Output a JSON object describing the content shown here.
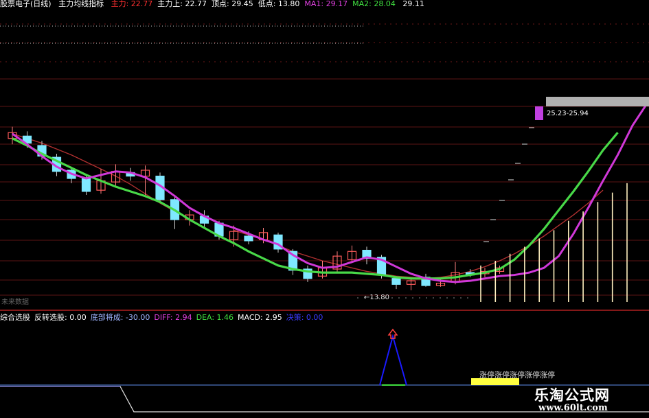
{
  "header": {
    "name": "股票电子(日线)",
    "indicator": "主力均线指标",
    "items": [
      {
        "label": "主力:",
        "value": "22.77",
        "color": "#ff3030"
      },
      {
        "label": "主力上:",
        "value": "22.77",
        "color": "#ffffff"
      },
      {
        "label": "顶点:",
        "value": "29.45",
        "color": "#ffffff"
      },
      {
        "label": "低点:",
        "value": "13.80",
        "color": "#ffffff"
      },
      {
        "label": "MA1:",
        "value": "29.17",
        "color": "#e040e0"
      },
      {
        "label": "MA2:",
        "value": "28.04",
        "color": "#40e040"
      },
      {
        "label": "",
        "value": "29.11",
        "color": "#ffffff"
      }
    ]
  },
  "indicator_bar": {
    "items": [
      {
        "text": "综合选股",
        "color": "#ffffff"
      },
      {
        "text": "反转选股: 0.00",
        "color": "#ffffff"
      },
      {
        "text": "底部将成: -30.00",
        "color": "#9fb4ff"
      },
      {
        "text": "DIFF: 2.94",
        "color": "#e040e0"
      },
      {
        "text": "DEA: 1.46",
        "color": "#40e040"
      },
      {
        "text": "MACD: 2.95",
        "color": "#ffffff"
      },
      {
        "text": "决策: 0.00",
        "color": "#3a3aff"
      }
    ]
  },
  "labels": {
    "low_marker": "←13.80",
    "target_range": "25.23-25.94",
    "future_days": "未来数据",
    "lower_text": "涨停涨停涨停涨停涨停"
  },
  "watermark": {
    "site_name": "乐淘公式网",
    "site_url": "www.60lt.com"
  },
  "colors": {
    "up_candle": "#ff5a5a",
    "down_candle": "#7fe8ff",
    "ma1": "#d038d8",
    "ma2": "#48d848",
    "ma3": "#b03030",
    "forecast_bar": "#fff0c0",
    "grid": "#7a1a1a"
  },
  "chart_data": [
    {
      "type": "candlestick",
      "title": "股票电子(日线)",
      "ylim": [
        12.5,
        30.0
      ],
      "low": 13.8,
      "high": 29.45,
      "target_range": [
        25.23,
        25.94
      ],
      "candles": [
        {
          "open": 26.4,
          "close": 26.9,
          "high": 27.4,
          "low": 25.9
        },
        {
          "open": 26.6,
          "close": 26.0,
          "high": 27.0,
          "low": 25.6
        },
        {
          "open": 25.8,
          "close": 24.9,
          "high": 26.2,
          "low": 24.6
        },
        {
          "open": 24.8,
          "close": 23.6,
          "high": 25.1,
          "low": 23.2
        },
        {
          "open": 23.7,
          "close": 23.0,
          "high": 24.0,
          "low": 22.6
        },
        {
          "open": 23.0,
          "close": 21.9,
          "high": 23.3,
          "low": 21.6
        },
        {
          "open": 22.0,
          "close": 22.8,
          "high": 23.8,
          "low": 21.7
        },
        {
          "open": 22.7,
          "close": 23.6,
          "high": 24.2,
          "low": 22.4
        },
        {
          "open": 23.5,
          "close": 23.2,
          "high": 23.9,
          "low": 22.8
        },
        {
          "open": 23.2,
          "close": 23.7,
          "high": 24.1,
          "low": 21.4
        },
        {
          "open": 23.2,
          "close": 21.2,
          "high": 23.5,
          "low": 20.9
        },
        {
          "open": 21.2,
          "close": 19.5,
          "high": 21.5,
          "low": 18.7
        },
        {
          "open": 19.5,
          "close": 19.9,
          "high": 20.3,
          "low": 19.0
        },
        {
          "open": 19.8,
          "close": 19.2,
          "high": 20.3,
          "low": 18.8
        },
        {
          "open": 19.2,
          "close": 18.1,
          "high": 19.4,
          "low": 17.8
        },
        {
          "open": 17.8,
          "close": 18.5,
          "high": 19.0,
          "low": 17.2
        },
        {
          "open": 18.1,
          "close": 17.7,
          "high": 18.5,
          "low": 17.4
        },
        {
          "open": 17.8,
          "close": 18.4,
          "high": 18.8,
          "low": 17.5
        },
        {
          "open": 18.2,
          "close": 17.0,
          "high": 18.4,
          "low": 16.7
        },
        {
          "open": 16.8,
          "close": 15.2,
          "high": 17.0,
          "low": 14.8
        },
        {
          "open": 15.3,
          "close": 14.5,
          "high": 15.6,
          "low": 14.2
        },
        {
          "open": 14.7,
          "close": 15.4,
          "high": 16.0,
          "low": 14.5
        },
        {
          "open": 15.3,
          "close": 16.4,
          "high": 16.8,
          "low": 15.0
        },
        {
          "open": 16.1,
          "close": 16.8,
          "high": 17.3,
          "low": 15.8
        },
        {
          "open": 16.9,
          "close": 16.2,
          "high": 17.2,
          "low": 15.7
        },
        {
          "open": 16.3,
          "close": 14.8,
          "high": 16.5,
          "low": 14.5
        },
        {
          "open": 14.5,
          "close": 14.0,
          "high": 14.7,
          "low": 13.6
        },
        {
          "open": 14.0,
          "close": 14.3,
          "high": 14.6,
          "low": 13.5
        },
        {
          "open": 14.6,
          "close": 13.9,
          "high": 14.9,
          "low": 13.8
        },
        {
          "open": 13.9,
          "close": 14.1,
          "high": 14.5,
          "low": 13.8
        },
        {
          "open": 14.2,
          "close": 15.0,
          "high": 15.9,
          "low": 14.0
        },
        {
          "open": 15.0,
          "close": 14.8,
          "high": 15.3,
          "low": 14.6
        },
        {
          "open": 14.9,
          "close": 15.1,
          "high": 15.4,
          "low": 14.6
        },
        {
          "open": 15.1,
          "close": 15.4,
          "high": 15.6,
          "low": 14.9
        }
      ],
      "ma1": [
        26.8,
        25.9,
        24.9,
        24.0,
        23.4,
        23.0,
        23.3,
        23.6,
        23.5,
        23.1,
        22.4,
        21.5,
        20.5,
        19.8,
        19.2,
        18.8,
        18.3,
        17.8,
        17.4,
        16.5,
        15.8,
        15.4,
        15.5,
        15.9,
        16.3,
        16.1,
        15.5,
        14.9,
        14.5,
        14.3,
        14.2,
        14.3,
        14.5,
        14.7,
        14.8,
        15.0,
        15.4,
        16.4,
        18.3,
        20.5,
        22.8,
        25.0,
        27.5,
        29.4
      ],
      "ma2": [
        26.4,
        25.8,
        25.1,
        24.5,
        23.9,
        23.3,
        22.8,
        22.3,
        21.9,
        21.5,
        21.0,
        20.3,
        19.5,
        18.8,
        18.1,
        17.5,
        16.8,
        16.2,
        15.6,
        15.3,
        15.1,
        15.0,
        15.0,
        15.0,
        14.9,
        14.8,
        14.6,
        14.5,
        14.5,
        14.5,
        14.6,
        14.8,
        15.0,
        15.3,
        16.1,
        17.3,
        18.7,
        20.3,
        21.9,
        23.6,
        25.4,
        26.9
      ],
      "ma3": [
        26.8,
        26.4,
        26.0,
        25.5,
        25.0,
        24.4,
        23.8,
        23.2,
        22.5,
        21.7,
        20.9,
        20.2,
        null,
        null,
        null,
        18.6,
        18.2,
        17.8,
        17.3,
        16.8,
        16.4,
        16.0,
        15.7,
        15.4,
        15.1,
        14.9,
        14.7,
        14.6,
        14.5,
        14.6,
        14.8,
        15.1,
        15.5,
        16.0,
        16.6,
        17.3,
        18.1,
        19.0,
        19.9,
        20.9,
        22.0
      ],
      "forecast_bars": [
        15.6,
        16.0,
        16.6,
        17.2,
        17.9,
        18.6,
        19.4,
        20.2,
        21.0,
        21.8,
        22.6
      ]
    },
    {
      "type": "line",
      "title": "综合选股",
      "series": [
        {
          "name": "DIFF",
          "values": [
            -6,
            -6,
            -6,
            -6,
            -6,
            -6,
            -6,
            -6,
            -6,
            -6,
            -6,
            -6,
            -6,
            -6,
            -6,
            -6,
            -6,
            -6,
            -6,
            -6,
            -6,
            -6,
            -6,
            -6,
            -6,
            -6,
            -6,
            -6,
            -6,
            -6,
            -6,
            -6,
            -6
          ]
        },
        {
          "name": "DEA",
          "values": [
            -30,
            -30,
            -30,
            -30,
            -30,
            -30,
            -30,
            -30,
            -30,
            -30,
            -30,
            -30,
            -30,
            -30,
            -30,
            -30,
            -30,
            -30,
            -30,
            -30,
            -30,
            -30,
            -30,
            -30,
            -30,
            -30,
            -30,
            -30,
            -30,
            -30,
            -30,
            -30,
            -30
          ]
        }
      ],
      "signal_peak": 1
    }
  ]
}
